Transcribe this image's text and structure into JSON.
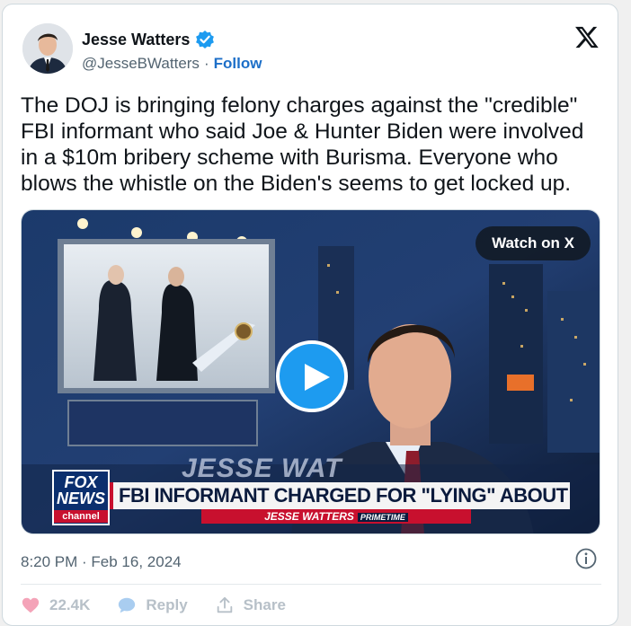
{
  "author": {
    "name": "Jesse Watters",
    "handle": "@JesseBWatters",
    "separator": "·",
    "follow_label": "Follow",
    "verified_color": "#1d9bf0"
  },
  "platform_icon": "x-logo-icon",
  "tweet": {
    "text": "The DOJ is bringing felony charges against the \"credible\"\nFBI informant who said Joe & Hunter Biden were involved\nin a $10m bribery scheme with Burisma. Everyone who\nblows the whistle on the Biden's seems to get locked up."
  },
  "media": {
    "watch_label": "Watch on X",
    "play_icon": "play-icon",
    "network_logo": {
      "line1": "FOX",
      "line2": "NEWS",
      "line3": "channel"
    },
    "ghost_name": "JESSE WAT",
    "chyron": "FBI INFORMANT CHARGED FOR \"LYING\" ABOUT BIDEN",
    "show_name": "JESSE WATTERS",
    "show_tag": "PRIMETIME"
  },
  "timestamp": "8:20 PM · Feb 16, 2024",
  "info_icon": "info-icon",
  "actions": {
    "like_count": "22.4K",
    "reply_label": "Reply",
    "share_label": "Share"
  },
  "colors": {
    "accent": "#1d9bf0",
    "follow": "#1d6fc8",
    "like": "#f4a3b8",
    "muted": "#536471"
  }
}
